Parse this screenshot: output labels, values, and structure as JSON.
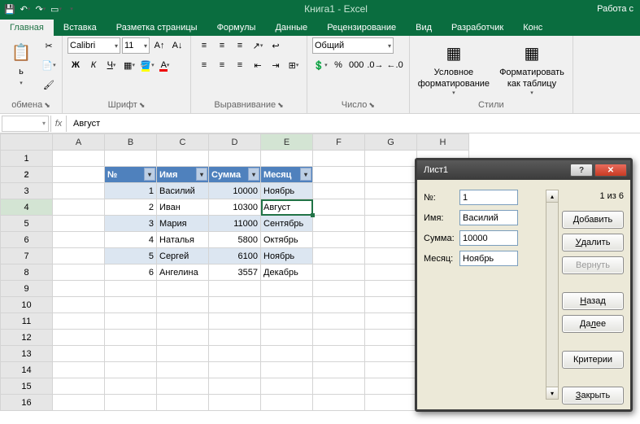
{
  "title": "Книга1 - Excel",
  "title_right": "Работа с",
  "tabs": [
    "Главная",
    "Вставка",
    "Разметка страницы",
    "Формулы",
    "Данные",
    "Рецензирование",
    "Вид",
    "Разработчик",
    "Конс"
  ],
  "groups": {
    "clipboard": "обмена",
    "font": "Шрифт",
    "align": "Выравнивание",
    "number": "Число",
    "styles": "Стили"
  },
  "font": {
    "name": "Calibri",
    "size": "11"
  },
  "num_format": "Общий",
  "styles_btns": {
    "cond": "Условное\nформатирование",
    "tbl": "Форматировать\nкак таблицу"
  },
  "cellref": "",
  "formula": "Август",
  "cols": [
    "A",
    "B",
    "C",
    "D",
    "E",
    "F",
    "G",
    "H"
  ],
  "headers": [
    "№",
    "Имя",
    "Сумма",
    "Месяц"
  ],
  "rows": [
    {
      "n": "1",
      "name": "Василий",
      "sum": "10000",
      "month": "Ноябрь"
    },
    {
      "n": "2",
      "name": "Иван",
      "sum": "10300",
      "month": "Август"
    },
    {
      "n": "3",
      "name": "Мария",
      "sum": "11000",
      "month": "Сентябрь"
    },
    {
      "n": "4",
      "name": "Наталья",
      "sum": "5800",
      "month": "Октябрь"
    },
    {
      "n": "5",
      "name": "Сергей",
      "sum": "6100",
      "month": "Ноябрь"
    },
    {
      "n": "6",
      "name": "Ангелина",
      "sum": "3557",
      "month": "Декабрь"
    }
  ],
  "dialog": {
    "title": "Лист1",
    "counter": "1 из 6",
    "fields": [
      {
        "label": "№:",
        "value": "1"
      },
      {
        "label": "Имя:",
        "value": "Василий"
      },
      {
        "label": "Сумма:",
        "value": "10000"
      },
      {
        "label": "Месяц:",
        "value": "Ноябрь"
      }
    ],
    "buttons": {
      "add": "Добавить",
      "del": "Удалить",
      "ret": "Вернуть",
      "back": "Назад",
      "next": "Далее",
      "crit": "Критерии",
      "close": "Закрыть"
    }
  }
}
